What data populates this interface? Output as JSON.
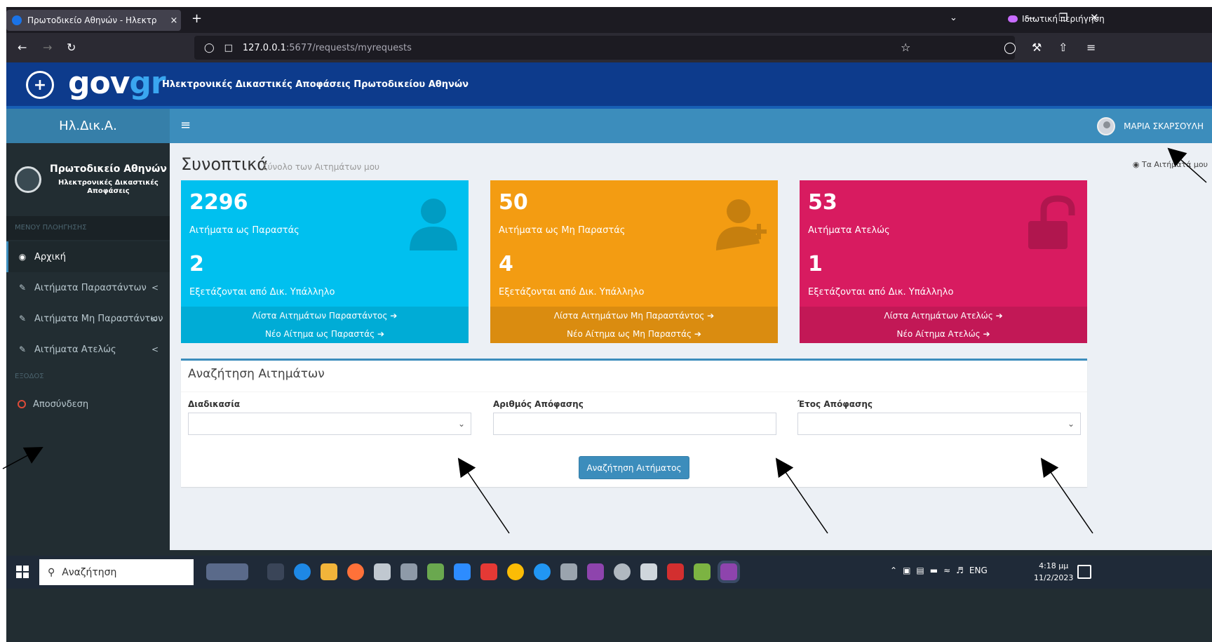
{
  "browser": {
    "tab_title": "Πρωτοδικείο Αθηνών - Ηλεκτρ",
    "tab_close": "×",
    "new_tab": "+",
    "private_label": "Ιδιωτική περιήγηση",
    "url_host": "127.0.0.1",
    "url_path": ":5677/requests/myrequests"
  },
  "gov": {
    "logo_gov": "gov",
    "logo_gr": "gr",
    "subtitle": "Ηλεκτρονικές Δικαστικές Αποφάσεις Πρωτοδικείου Αθηνών"
  },
  "header": {
    "brand": "Ηλ.Δικ.Α.",
    "menu_icon": "≡",
    "user_name": "ΜΑΡΙΑ ΣΚΑΡΣΟΥΛΗ"
  },
  "sidebar": {
    "org_name": "Πρωτοδικείο Αθηνών",
    "org_sub_1": "Ηλεκτρονικές Δικαστικές",
    "org_sub_2": "Αποφάσεις",
    "nav_header": "ΜΕΝΟΥ ΠΛΟΗΓΗΣΗΣ",
    "exit_header": "ΕΞΟΔΟΣ",
    "items": [
      {
        "label": "Αρχική",
        "icon": "dashboard-icon"
      },
      {
        "label": "Αιτήματα Παραστάντων",
        "icon": "edit-icon",
        "chevron": "<"
      },
      {
        "label": "Αιτήματα Μη Παραστάντων",
        "icon": "edit-icon",
        "chevron": "<"
      },
      {
        "label": "Αιτήματα Ατελώς",
        "icon": "edit-icon",
        "chevron": "<"
      }
    ],
    "logout": "Αποσύνδεση"
  },
  "page": {
    "title": "Συνοπτικά",
    "subtitle": "Σύνολο των Αιτημάτων μου",
    "breadcrumb": "Τα Αιτήματά μου"
  },
  "stats": [
    {
      "total": "2296",
      "total_label": "Αιτήματα ως Παραστάς",
      "pending": "2",
      "pending_label": "Εξετάζονται από Δικ. Υπάλληλο",
      "link1": "Λίστα Αιτημάτων Παραστάντος ➔",
      "link2": "Νέο Αίτημα ως Παραστάς ➔",
      "color": "#00c0ef",
      "icon": "user-icon"
    },
    {
      "total": "50",
      "total_label": "Αιτήματα ως Μη Παραστάς",
      "pending": "4",
      "pending_label": "Εξετάζονται από Δικ. Υπάλληλο",
      "link1": "Λίστα Αιτημάτων Μη Παραστάντος ➔",
      "link2": "Νέο Αίτημα ως Μη Παραστάς ➔",
      "color": "#f39c12",
      "icon": "user-plus-icon"
    },
    {
      "total": "53",
      "total_label": "Αιτήματα Ατελώς",
      "pending": "1",
      "pending_label": "Εξετάζονται από Δικ. Υπάλληλο",
      "link1": "Λίστα Αιτημάτων Ατελώς ➔",
      "link2": "Νέο Αίτημα Ατελώς ➔",
      "color": "#d81b60",
      "icon": "unlock-icon"
    }
  ],
  "search": {
    "title": "Αναζήτηση Αιτημάτων",
    "procedure_label": "Διαδικασία",
    "procedure_value": "",
    "decision_no_label": "Αριθμός Απόφασης",
    "decision_no_value": "",
    "year_label": "Έτος Απόφασης",
    "year_value": "",
    "button": "Αναζήτηση Αιτήματος"
  },
  "taskbar": {
    "search_placeholder": "Αναζήτηση",
    "lang": "ENG",
    "time": "4:18 μμ",
    "date": "11/2/2023"
  }
}
